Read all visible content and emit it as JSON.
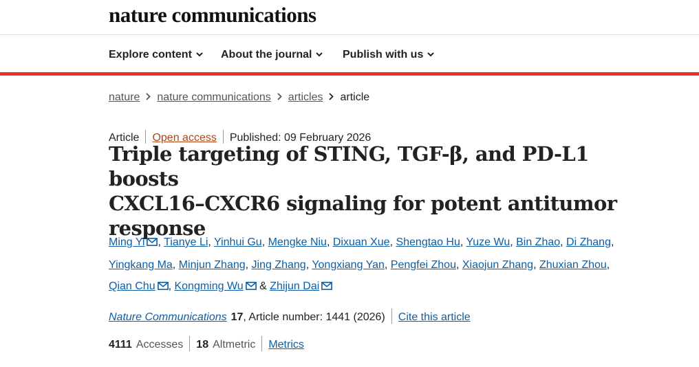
{
  "header": {
    "logo": "nature communications"
  },
  "nav": [
    {
      "label": "Explore content"
    },
    {
      "label": "About the journal"
    },
    {
      "label": "Publish with us"
    }
  ],
  "breadcrumb": [
    "nature",
    "nature communications",
    "articles",
    "article"
  ],
  "meta": {
    "type": "Article",
    "access": "Open access",
    "published": "Published: 09 February 2026"
  },
  "title_lines": [
    "Triple targeting of STING, TGF-β, and PD-L1 boosts",
    "CXCL16–CXCR6 signaling for potent antitumor",
    "response"
  ],
  "authors": [
    "Ming Yi",
    "Tianye Li",
    "Yinhui Gu",
    "Mengke Niu",
    "Dixuan Xue",
    "Shengtao Hu",
    "Yuze Wu",
    "Bin Zhao",
    "Di Zhang",
    "Yingkang Ma",
    "Minjun Zhang",
    "Jing Zhang",
    "Yongxiang Yan",
    "Pengfei Zhou",
    "Xiaojun Zhang",
    "Zhuxian Zhou",
    "Qian Chu",
    "Kongming Wu",
    "Zhijun Dai"
  ],
  "author_sep": ", ",
  "author_and": " & ",
  "journal": {
    "name": "Nature Communications",
    "volume": "17",
    "article_number": ", Article number: 1441 (2026)",
    "cite_label": "Cite this article"
  },
  "metrics": {
    "accesses_value": "4111",
    "accesses_label": "Accesses",
    "altmetric_value": "18",
    "altmetric_label": "Altmetric",
    "metrics_link": "Metrics"
  },
  "colors": {
    "accent_red": "#e0352c",
    "link_blue": "#0c5ea6",
    "open_access": "#b14414"
  },
  "icons": {
    "nav_chevron": "chevron-down-icon",
    "breadcrumb_sep": "chevron-right-icon",
    "author_mail": "mail-icon"
  }
}
